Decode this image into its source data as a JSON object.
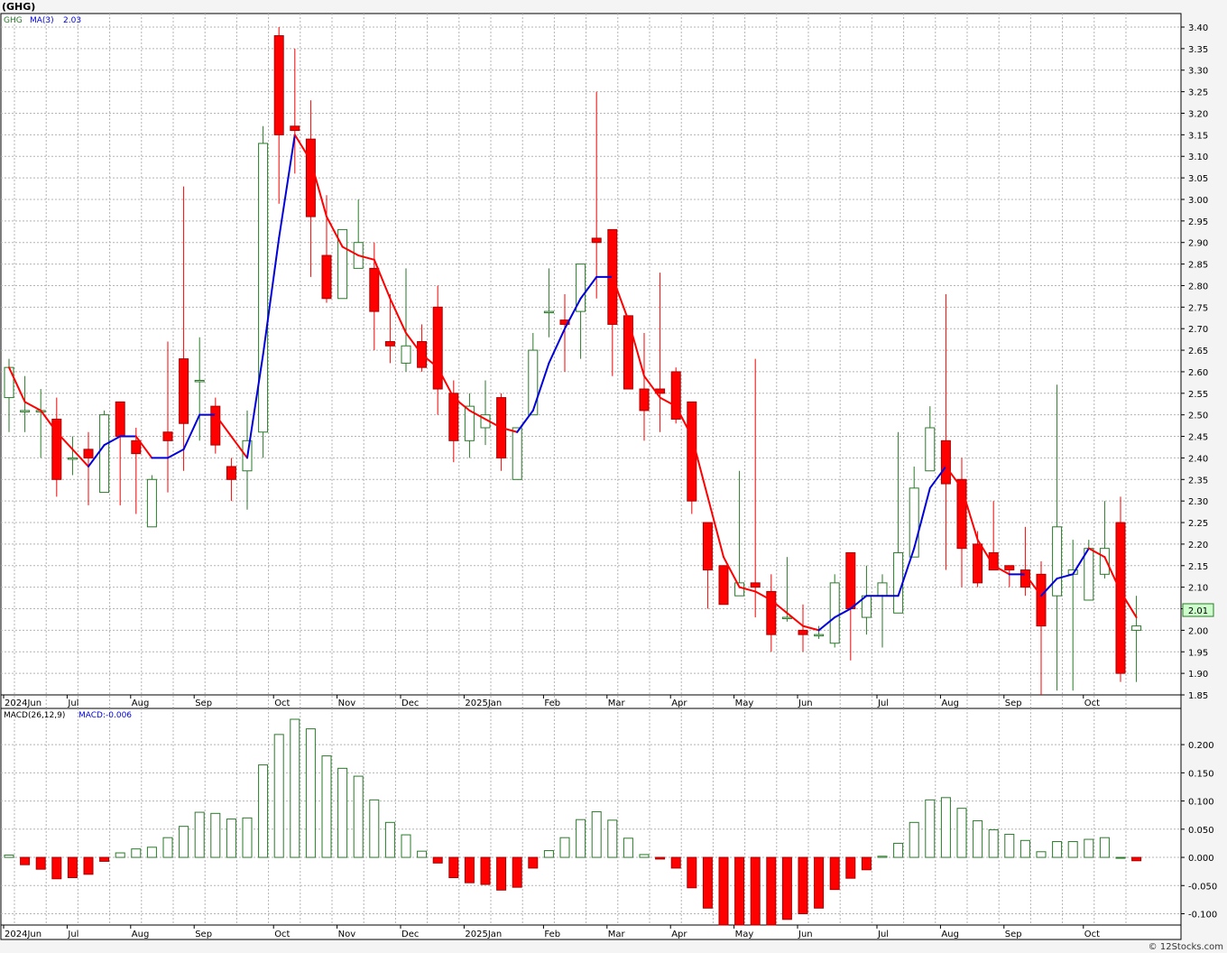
{
  "header": {
    "symbol_title": "(GHG)"
  },
  "legend": {
    "ticker": "GHG",
    "ma_label": "MA(3)",
    "ma_value": "2.03"
  },
  "macd_legend": {
    "label": "MACD(26,12,9)",
    "value_label": "MACD:-0.006"
  },
  "last_price_label": "2.01",
  "footer": {
    "copyright": "© 12Stocks.com"
  },
  "colors": {
    "up": "#2a7a2a",
    "down": "#ff0000",
    "ma_up": "#0000dd",
    "ma_down": "#ff0000",
    "grid": "#b4b4b4",
    "last_box": "#ccffcc"
  },
  "chart_data": [
    {
      "type": "candlestick",
      "title": "(GHG)",
      "ylim": [
        1.85,
        3.4
      ],
      "y_ticks": [
        "1.85",
        "1.90",
        "1.95",
        "2.00",
        "2.05",
        "2.10",
        "2.15",
        "2.20",
        "2.25",
        "2.30",
        "2.35",
        "2.40",
        "2.45",
        "2.50",
        "2.55",
        "2.60",
        "2.65",
        "2.70",
        "2.75",
        "2.80",
        "2.85",
        "2.90",
        "2.95",
        "3.00",
        "3.05",
        "3.10",
        "3.15",
        "3.20",
        "3.25",
        "3.30",
        "3.35",
        "3.40"
      ],
      "y_tick_values": [
        1.85,
        1.9,
        1.95,
        2.0,
        2.05,
        2.1,
        2.15,
        2.2,
        2.25,
        2.3,
        2.35,
        2.4,
        2.45,
        2.5,
        2.55,
        2.6,
        2.65,
        2.7,
        2.75,
        2.8,
        2.85,
        2.9,
        2.95,
        3.0,
        3.05,
        3.1,
        3.15,
        3.2,
        3.25,
        3.3,
        3.35,
        3.4
      ],
      "x_tick_labels": [
        "2024Jun",
        "Jul",
        "Aug",
        "Sep",
        "Oct",
        "Nov",
        "Dec",
        "2025Jan",
        "Feb",
        "Mar",
        "Apr",
        "May",
        "Jun",
        "Jul",
        "Aug",
        "Sep",
        "Oct"
      ],
      "x_tick_index": [
        0,
        4,
        8,
        12,
        17,
        21,
        25,
        29,
        34,
        38,
        42,
        46,
        50,
        55,
        59,
        63,
        68
      ],
      "candles": [
        {
          "o": 2.54,
          "h": 2.63,
          "l": 2.46,
          "c": 2.61
        },
        {
          "o": 2.51,
          "h": 2.59,
          "l": 2.46,
          "c": 2.51
        },
        {
          "o": 2.51,
          "h": 2.56,
          "l": 2.4,
          "c": 2.51
        },
        {
          "o": 2.49,
          "h": 2.54,
          "l": 2.31,
          "c": 2.35
        },
        {
          "o": 2.4,
          "h": 2.45,
          "l": 2.36,
          "c": 2.4
        },
        {
          "o": 2.42,
          "h": 2.46,
          "l": 2.29,
          "c": 2.4
        },
        {
          "o": 2.32,
          "h": 2.51,
          "l": 2.32,
          "c": 2.5
        },
        {
          "o": 2.53,
          "h": 2.53,
          "l": 2.29,
          "c": 2.45
        },
        {
          "o": 2.44,
          "h": 2.47,
          "l": 2.27,
          "c": 2.41
        },
        {
          "o": 2.24,
          "h": 2.36,
          "l": 2.24,
          "c": 2.35
        },
        {
          "o": 2.46,
          "h": 2.67,
          "l": 2.32,
          "c": 2.44
        },
        {
          "o": 2.63,
          "h": 3.03,
          "l": 2.37,
          "c": 2.48
        },
        {
          "o": 2.58,
          "h": 2.68,
          "l": 2.44,
          "c": 2.58
        },
        {
          "o": 2.52,
          "h": 2.54,
          "l": 2.41,
          "c": 2.43
        },
        {
          "o": 2.38,
          "h": 2.4,
          "l": 2.3,
          "c": 2.35
        },
        {
          "o": 2.37,
          "h": 2.51,
          "l": 2.28,
          "c": 2.44
        },
        {
          "o": 2.46,
          "h": 3.17,
          "l": 2.4,
          "c": 3.13
        },
        {
          "o": 3.38,
          "h": 3.4,
          "l": 2.99,
          "c": 3.15
        },
        {
          "o": 3.17,
          "h": 3.35,
          "l": 3.06,
          "c": 3.16
        },
        {
          "o": 3.14,
          "h": 3.23,
          "l": 2.82,
          "c": 2.96
        },
        {
          "o": 2.87,
          "h": 3.01,
          "l": 2.76,
          "c": 2.77
        },
        {
          "o": 2.77,
          "h": 2.93,
          "l": 2.77,
          "c": 2.93
        },
        {
          "o": 2.84,
          "h": 3.0,
          "l": 2.84,
          "c": 2.9
        },
        {
          "o": 2.84,
          "h": 2.9,
          "l": 2.65,
          "c": 2.74
        },
        {
          "o": 2.67,
          "h": 2.78,
          "l": 2.62,
          "c": 2.66
        },
        {
          "o": 2.62,
          "h": 2.84,
          "l": 2.6,
          "c": 2.66
        },
        {
          "o": 2.67,
          "h": 2.71,
          "l": 2.6,
          "c": 2.61
        },
        {
          "o": 2.75,
          "h": 2.8,
          "l": 2.5,
          "c": 2.56
        },
        {
          "o": 2.55,
          "h": 2.58,
          "l": 2.39,
          "c": 2.44
        },
        {
          "o": 2.44,
          "h": 2.55,
          "l": 2.4,
          "c": 2.52
        },
        {
          "o": 2.47,
          "h": 2.58,
          "l": 2.43,
          "c": 2.5
        },
        {
          "o": 2.54,
          "h": 2.55,
          "l": 2.37,
          "c": 2.4
        },
        {
          "o": 2.35,
          "h": 2.47,
          "l": 2.35,
          "c": 2.47
        },
        {
          "o": 2.5,
          "h": 2.69,
          "l": 2.5,
          "c": 2.65
        },
        {
          "o": 2.74,
          "h": 2.84,
          "l": 2.68,
          "c": 2.74
        },
        {
          "o": 2.72,
          "h": 2.78,
          "l": 2.6,
          "c": 2.71
        },
        {
          "o": 2.74,
          "h": 2.85,
          "l": 2.63,
          "c": 2.85
        },
        {
          "o": 2.91,
          "h": 3.25,
          "l": 2.77,
          "c": 2.9
        },
        {
          "o": 2.93,
          "h": 2.93,
          "l": 2.59,
          "c": 2.71
        },
        {
          "o": 2.73,
          "h": 2.73,
          "l": 2.56,
          "c": 2.56
        },
        {
          "o": 2.56,
          "h": 2.69,
          "l": 2.44,
          "c": 2.51
        },
        {
          "o": 2.56,
          "h": 2.83,
          "l": 2.46,
          "c": 2.55
        },
        {
          "o": 2.6,
          "h": 2.61,
          "l": 2.48,
          "c": 2.49
        },
        {
          "o": 2.53,
          "h": 2.53,
          "l": 2.27,
          "c": 2.3
        },
        {
          "o": 2.25,
          "h": 2.25,
          "l": 2.05,
          "c": 2.14
        },
        {
          "o": 2.15,
          "h": 2.15,
          "l": 2.06,
          "c": 2.06
        },
        {
          "o": 2.08,
          "h": 2.37,
          "l": 2.08,
          "c": 2.11
        },
        {
          "o": 2.11,
          "h": 2.63,
          "l": 2.03,
          "c": 2.1
        },
        {
          "o": 2.09,
          "h": 2.13,
          "l": 1.95,
          "c": 1.99
        },
        {
          "o": 2.03,
          "h": 2.17,
          "l": 2.02,
          "c": 2.03
        },
        {
          "o": 2.0,
          "h": 2.06,
          "l": 1.95,
          "c": 1.99
        },
        {
          "o": 1.99,
          "h": 2.01,
          "l": 1.98,
          "c": 1.99
        },
        {
          "o": 1.97,
          "h": 2.13,
          "l": 1.96,
          "c": 2.11
        },
        {
          "o": 2.18,
          "h": 2.18,
          "l": 1.93,
          "c": 2.05
        },
        {
          "o": 2.03,
          "h": 2.15,
          "l": 1.99,
          "c": 2.08
        },
        {
          "o": 2.08,
          "h": 2.13,
          "l": 1.96,
          "c": 2.11
        },
        {
          "o": 2.04,
          "h": 2.46,
          "l": 2.04,
          "c": 2.18
        },
        {
          "o": 2.17,
          "h": 2.38,
          "l": 2.17,
          "c": 2.33
        },
        {
          "o": 2.37,
          "h": 2.52,
          "l": 2.37,
          "c": 2.47
        },
        {
          "o": 2.44,
          "h": 2.78,
          "l": 2.14,
          "c": 2.34
        },
        {
          "o": 2.35,
          "h": 2.4,
          "l": 2.1,
          "c": 2.19
        },
        {
          "o": 2.2,
          "h": 2.23,
          "l": 2.1,
          "c": 2.11
        },
        {
          "o": 2.18,
          "h": 2.3,
          "l": 2.14,
          "c": 2.14
        },
        {
          "o": 2.15,
          "h": 2.15,
          "l": 2.1,
          "c": 2.14
        },
        {
          "o": 2.14,
          "h": 2.24,
          "l": 2.08,
          "c": 2.1
        },
        {
          "o": 2.13,
          "h": 2.16,
          "l": 1.85,
          "c": 2.01
        },
        {
          "o": 2.08,
          "h": 2.57,
          "l": 1.86,
          "c": 2.24
        },
        {
          "o": 2.13,
          "h": 2.21,
          "l": 1.86,
          "c": 2.14
        },
        {
          "o": 2.07,
          "h": 2.21,
          "l": 2.07,
          "c": 2.19
        },
        {
          "o": 2.13,
          "h": 2.3,
          "l": 2.12,
          "c": 2.19
        },
        {
          "o": 2.25,
          "h": 2.31,
          "l": 1.88,
          "c": 1.9
        },
        {
          "o": 2.0,
          "h": 2.08,
          "l": 1.88,
          "c": 2.01
        }
      ],
      "ma3": [
        2.61,
        2.53,
        2.51,
        2.46,
        2.42,
        2.38,
        2.43,
        2.45,
        2.45,
        2.4,
        2.4,
        2.42,
        2.5,
        2.5,
        2.45,
        2.4,
        2.64,
        2.91,
        3.15,
        3.09,
        2.96,
        2.89,
        2.87,
        2.86,
        2.77,
        2.69,
        2.64,
        2.61,
        2.54,
        2.51,
        2.49,
        2.47,
        2.46,
        2.51,
        2.62,
        2.7,
        2.77,
        2.82,
        2.82,
        2.72,
        2.59,
        2.54,
        2.52,
        2.45,
        2.31,
        2.17,
        2.1,
        2.09,
        2.07,
        2.04,
        2.01,
        2.0,
        2.03,
        2.05,
        2.08,
        2.08,
        2.08,
        2.19,
        2.33,
        2.38,
        2.33,
        2.21,
        2.15,
        2.13,
        2.13,
        2.08,
        2.12,
        2.13,
        2.19,
        2.17,
        2.09,
        2.03
      ]
    },
    {
      "type": "bar",
      "title": "MACD(26,12,9)",
      "ylim": [
        -0.12,
        0.245
      ],
      "y_ticks": [
        "0.200",
        "0.150",
        "0.100",
        "0.050",
        "0.000",
        "-0.050",
        "-0.100"
      ],
      "y_tick_values": [
        0.2,
        0.15,
        0.1,
        0.05,
        0.0,
        -0.05,
        -0.1
      ],
      "values": [
        0.004,
        -0.013,
        -0.021,
        -0.038,
        -0.036,
        -0.03,
        -0.007,
        0.008,
        0.015,
        0.018,
        0.035,
        0.055,
        0.08,
        0.078,
        0.068,
        0.07,
        0.164,
        0.218,
        0.245,
        0.228,
        0.18,
        0.158,
        0.144,
        0.102,
        0.062,
        0.04,
        0.011,
        -0.01,
        -0.036,
        -0.045,
        -0.048,
        -0.058,
        -0.053,
        -0.019,
        0.012,
        0.035,
        0.067,
        0.081,
        0.066,
        0.034,
        0.005,
        -0.003,
        -0.019,
        -0.054,
        -0.09,
        -0.12,
        -0.12,
        -0.12,
        -0.12,
        -0.11,
        -0.1,
        -0.09,
        -0.057,
        -0.037,
        -0.022,
        0.002,
        0.025,
        0.062,
        0.102,
        0.106,
        0.087,
        0.065,
        0.049,
        0.041,
        0.03,
        0.01,
        0.028,
        0.028,
        0.032,
        0.035,
        0.0,
        -0.006
      ]
    }
  ]
}
